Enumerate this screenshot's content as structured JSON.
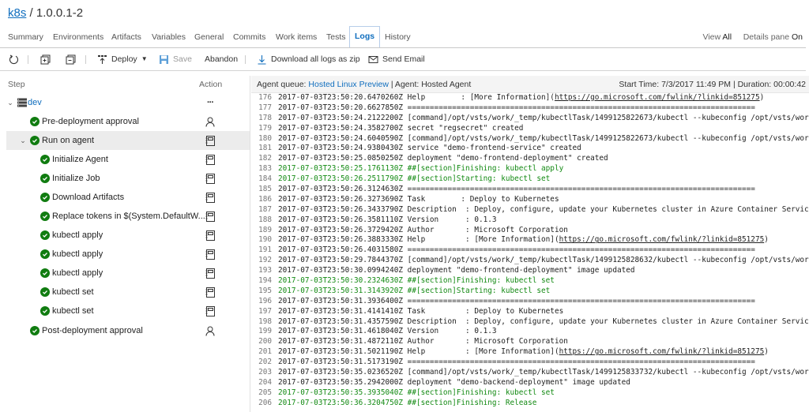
{
  "header": {
    "project_link": "k8s",
    "separator": " / ",
    "release": "1.0.0.1-2"
  },
  "tabs": [
    {
      "label": "Summary"
    },
    {
      "label": "Environments"
    },
    {
      "label": "Artifacts"
    },
    {
      "label": "Variables"
    },
    {
      "label": "General"
    },
    {
      "label": "Commits"
    },
    {
      "label": "Work items"
    },
    {
      "label": "Tests"
    },
    {
      "label": "Logs",
      "active": true
    },
    {
      "label": "History"
    }
  ],
  "view": {
    "label": "View",
    "value": "All",
    "details_label": "Details pane",
    "details_value": "On"
  },
  "toolbar": {
    "deploy": "Deploy",
    "save": "Save",
    "abandon": "Abandon",
    "download": "Download all logs as zip",
    "email": "Send Email"
  },
  "steps_panel": {
    "step_header": "Step",
    "action_header": "Action",
    "rows": [
      {
        "label": "dev",
        "type": "environment",
        "action": "more-icon"
      },
      {
        "label": "Pre-deployment approval",
        "action": "person-icon"
      },
      {
        "label": "Run on agent",
        "action": "log-icon",
        "expanded": true
      },
      {
        "label": "Initialize Agent",
        "action": "log-icon"
      },
      {
        "label": "Initialize Job",
        "action": "log-icon"
      },
      {
        "label": "Download Artifacts",
        "action": "log-icon"
      },
      {
        "label": "Replace tokens in $(System.DefaultW...",
        "action": "log-icon"
      },
      {
        "label": "kubectl apply",
        "action": "log-icon"
      },
      {
        "label": "kubectl apply",
        "action": "log-icon"
      },
      {
        "label": "kubectl apply",
        "action": "log-icon"
      },
      {
        "label": "kubectl set",
        "action": "log-icon"
      },
      {
        "label": "kubectl set",
        "action": "log-icon"
      },
      {
        "label": "Post-deployment approval",
        "action": "person-icon"
      }
    ]
  },
  "agent_bar": {
    "queue_label": "Agent queue: ",
    "queue_value": "Hosted Linux Preview",
    "agent_text": " | Agent: Hosted Agent",
    "timing": "Start Time: 7/3/2017 11:49 PM | Duration: 00:00:42"
  },
  "log_lines": [
    {
      "n": "176",
      "t": "2017-07-03T23:50:20.6470260Z Help        : [More Information](",
      "url": "https://go.microsoft.com/fwlink/?linkid=851275",
      "after": ")"
    },
    {
      "n": "177",
      "t": "2017-07-03T23:50:20.6627850Z =============================================================================="
    },
    {
      "n": "178",
      "t": "2017-07-03T23:50:24.2122200Z [command]/opt/vsts/work/_temp/kubectlTask/1499125822673/kubectl --kubeconfig /opt/vsts/work/_temp/"
    },
    {
      "n": "179",
      "t": "2017-07-03T23:50:24.3582700Z secret \"regsecret\" created"
    },
    {
      "n": "180",
      "t": "2017-07-03T23:50:24.6040590Z [command]/opt/vsts/work/_temp/kubectlTask/1499125822673/kubectl --kubeconfig /opt/vsts/work/_temp/"
    },
    {
      "n": "181",
      "t": "2017-07-03T23:50:24.9380430Z service \"demo-frontend-service\" created"
    },
    {
      "n": "182",
      "t": "2017-07-03T23:50:25.0850250Z deployment \"demo-frontend-deployment\" created"
    },
    {
      "n": "183",
      "t": "2017-07-03T23:50:25.1761130Z ##[section]Finishing: kubectl apply",
      "green": true
    },
    {
      "n": "184",
      "t": "2017-07-03T23:50:26.2511790Z ##[section]Starting: kubectl set",
      "green": true
    },
    {
      "n": "185",
      "t": "2017-07-03T23:50:26.3124630Z =============================================================================="
    },
    {
      "n": "186",
      "t": "2017-07-03T23:50:26.3273690Z Task        : Deploy to Kubernetes"
    },
    {
      "n": "187",
      "t": "2017-07-03T23:50:26.3433790Z Description  : Deploy, configure, update your Kubernetes cluster in Azure Container Service by run"
    },
    {
      "n": "188",
      "t": "2017-07-03T23:50:26.3581110Z Version      : 0.1.3"
    },
    {
      "n": "189",
      "t": "2017-07-03T23:50:26.3729420Z Author       : Microsoft Corporation"
    },
    {
      "n": "190",
      "t": "2017-07-03T23:50:26.3883330Z Help         : [More Information](",
      "url": "https://go.microsoft.com/fwlink/?linkid=851275",
      "after": ")"
    },
    {
      "n": "191",
      "t": "2017-07-03T23:50:26.4031580Z =============================================================================="
    },
    {
      "n": "192",
      "t": "2017-07-03T23:50:29.7844370Z [command]/opt/vsts/work/_temp/kubectlTask/1499125828632/kubectl --kubeconfig /opt/vsts/work/_temp/"
    },
    {
      "n": "193",
      "t": "2017-07-03T23:50:30.0994240Z deployment \"demo-frontend-deployment\" image updated"
    },
    {
      "n": "194",
      "t": "2017-07-03T23:50:30.2324630Z ##[section]Finishing: kubectl set",
      "green": true
    },
    {
      "n": "195",
      "t": "2017-07-03T23:50:31.3143920Z ##[section]Starting: kubectl set",
      "green": true
    },
    {
      "n": "196",
      "t": "2017-07-03T23:50:31.3936400Z =============================================================================="
    },
    {
      "n": "197",
      "t": "2017-07-03T23:50:31.4141410Z Task         : Deploy to Kubernetes"
    },
    {
      "n": "198",
      "t": "2017-07-03T23:50:31.4357590Z Description  : Deploy, configure, update your Kubernetes cluster in Azure Container Service by run"
    },
    {
      "n": "199",
      "t": "2017-07-03T23:50:31.4618040Z Version      : 0.1.3"
    },
    {
      "n": "200",
      "t": "2017-07-03T23:50:31.4872110Z Author       : Microsoft Corporation"
    },
    {
      "n": "201",
      "t": "2017-07-03T23:50:31.5021190Z Help         : [More Information](",
      "url": "https://go.microsoft.com/fwlink/?linkid=851275",
      "after": ")"
    },
    {
      "n": "202",
      "t": "2017-07-03T23:50:31.5173190Z =============================================================================="
    },
    {
      "n": "203",
      "t": "2017-07-03T23:50:35.0236520Z [command]/opt/vsts/work/_temp/kubectlTask/1499125833732/kubectl --kubeconfig /opt/vsts/work/_temp/"
    },
    {
      "n": "204",
      "t": "2017-07-03T23:50:35.2942000Z deployment \"demo-backend-deployment\" image updated"
    },
    {
      "n": "205",
      "t": "2017-07-03T23:50:35.3935040Z ##[section]Finishing: kubectl set",
      "green": true
    },
    {
      "n": "206",
      "t": "2017-07-03T23:50:36.3204750Z ##[section]Finishing: Release",
      "green": true
    }
  ],
  "colors": {
    "accent": "#106ebe",
    "success": "#107c10",
    "log_section": "#138a13"
  }
}
